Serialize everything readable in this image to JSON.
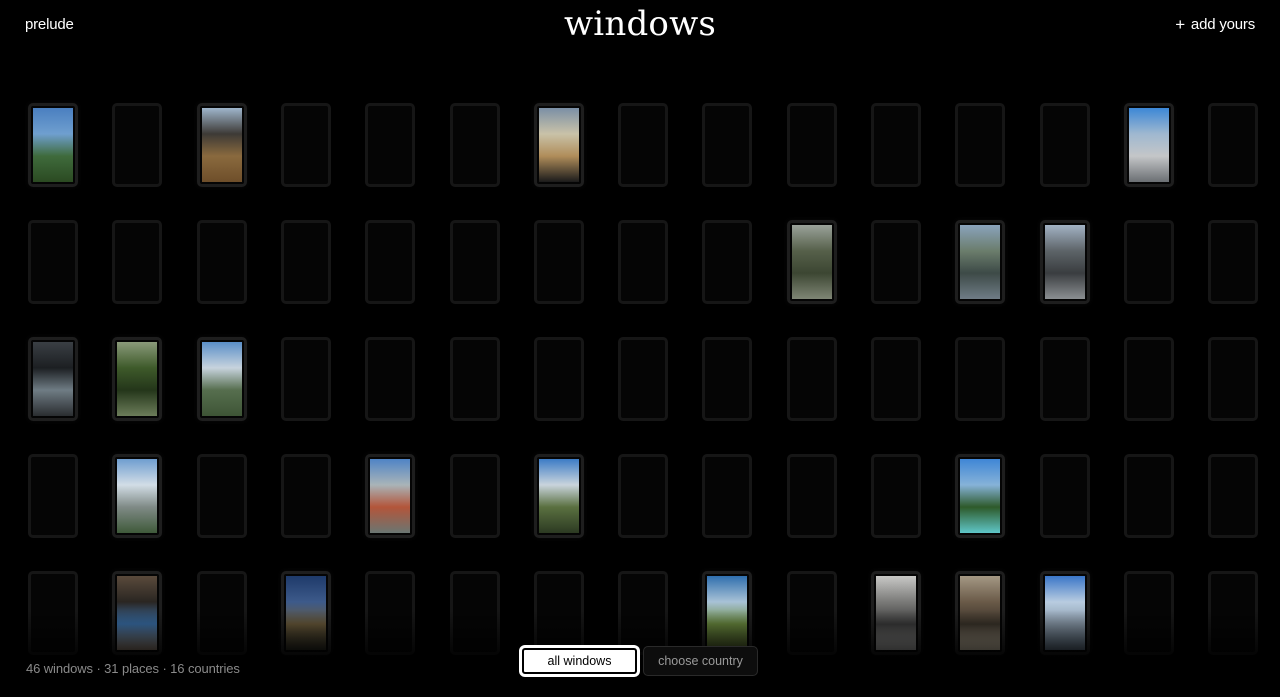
{
  "header": {
    "prelude_label": "prelude",
    "title": "windows",
    "add_label": "add yours",
    "add_icon": "plus-icon"
  },
  "footer": {
    "stats": "46 windows · 31 places · 16 countries",
    "filters": [
      {
        "label": "all windows",
        "active": true
      },
      {
        "label": "choose country",
        "active": false
      }
    ]
  },
  "grid": {
    "columns": 15,
    "rows": 5,
    "frame_color": "#161616",
    "photos": [
      {
        "row": 0,
        "col": 0,
        "scene": "mountains-sky",
        "colors": [
          "#4a7fc0",
          "#6f9fcf",
          "#3f6b3c",
          "#2b4a22"
        ]
      },
      {
        "row": 0,
        "col": 2,
        "scene": "wooden-rooftop",
        "colors": [
          "#9fb6cc",
          "#3d3a36",
          "#8a6a3e",
          "#6e4e2a"
        ]
      },
      {
        "row": 0,
        "col": 6,
        "scene": "cloudy-sunset",
        "colors": [
          "#7b8fa6",
          "#c9c2a8",
          "#b08d5a",
          "#1b1b1b"
        ]
      },
      {
        "row": 0,
        "col": 13,
        "scene": "apartment-building",
        "colors": [
          "#3c87d6",
          "#9fb8d0",
          "#c4c6c8",
          "#6b6f73"
        ]
      },
      {
        "row": 1,
        "col": 9,
        "scene": "tree-branches",
        "colors": [
          "#9aa29a",
          "#56604a",
          "#3c4632",
          "#7f8675"
        ]
      },
      {
        "row": 1,
        "col": 11,
        "scene": "street-hill",
        "colors": [
          "#8aa3bc",
          "#6b7d6c",
          "#3d4a47",
          "#6f7c86"
        ]
      },
      {
        "row": 1,
        "col": 12,
        "scene": "parking-lot",
        "colors": [
          "#a2b2c4",
          "#5d6468",
          "#3a3d40",
          "#8b8f92"
        ]
      },
      {
        "row": 2,
        "col": 0,
        "scene": "dark-blinds",
        "colors": [
          "#3a3f44",
          "#1c1f22",
          "#6f7c84",
          "#2a2d30"
        ]
      },
      {
        "row": 2,
        "col": 1,
        "scene": "green-tree",
        "colors": [
          "#8a9a7a",
          "#3e5a2a",
          "#24361a",
          "#6c7d5a"
        ]
      },
      {
        "row": 2,
        "col": 2,
        "scene": "city-clouds",
        "colors": [
          "#5a8fc8",
          "#c7d3dd",
          "#566e4e",
          "#3e5536"
        ]
      },
      {
        "row": 3,
        "col": 1,
        "scene": "tower-clouds",
        "colors": [
          "#6f9ed0",
          "#d2dde6",
          "#7f8a86",
          "#3f5a3a"
        ]
      },
      {
        "row": 3,
        "col": 4,
        "scene": "red-roofs",
        "colors": [
          "#4f84c6",
          "#a9b4b8",
          "#b3553a",
          "#6a7672"
        ]
      },
      {
        "row": 3,
        "col": 6,
        "scene": "mountain-view",
        "colors": [
          "#3c7cc6",
          "#c9d4dc",
          "#5a7040",
          "#2c3a22"
        ]
      },
      {
        "row": 3,
        "col": 11,
        "scene": "palm-trees",
        "colors": [
          "#3f86d6",
          "#86b2d8",
          "#2e5a2a",
          "#5fc6c8"
        ]
      },
      {
        "row": 4,
        "col": 1,
        "scene": "glass-building",
        "colors": [
          "#5a4a3c",
          "#2a2622",
          "#3a6fa8",
          "#8a7a6a"
        ]
      },
      {
        "row": 4,
        "col": 3,
        "scene": "night-building",
        "colors": [
          "#1e3a6a",
          "#3d5a8a",
          "#6a5a3a",
          "#2a2a22"
        ]
      },
      {
        "row": 4,
        "col": 8,
        "scene": "green-field",
        "colors": [
          "#2f6fae",
          "#a8c2d6",
          "#6a8a3e",
          "#4a5a2a"
        ]
      },
      {
        "row": 4,
        "col": 10,
        "scene": "stairs",
        "colors": [
          "#c8c8c6",
          "#7a7a78",
          "#3a3a3a",
          "#a6a6a4"
        ]
      },
      {
        "row": 4,
        "col": 11,
        "scene": "scaffold",
        "colors": [
          "#a49884",
          "#6a5a48",
          "#3a332a",
          "#c9bda6"
        ]
      },
      {
        "row": 4,
        "col": 12,
        "scene": "cityscape-blue",
        "colors": [
          "#3a76c8",
          "#b8cce0",
          "#8a9aaa",
          "#5a6a7a"
        ]
      }
    ]
  }
}
